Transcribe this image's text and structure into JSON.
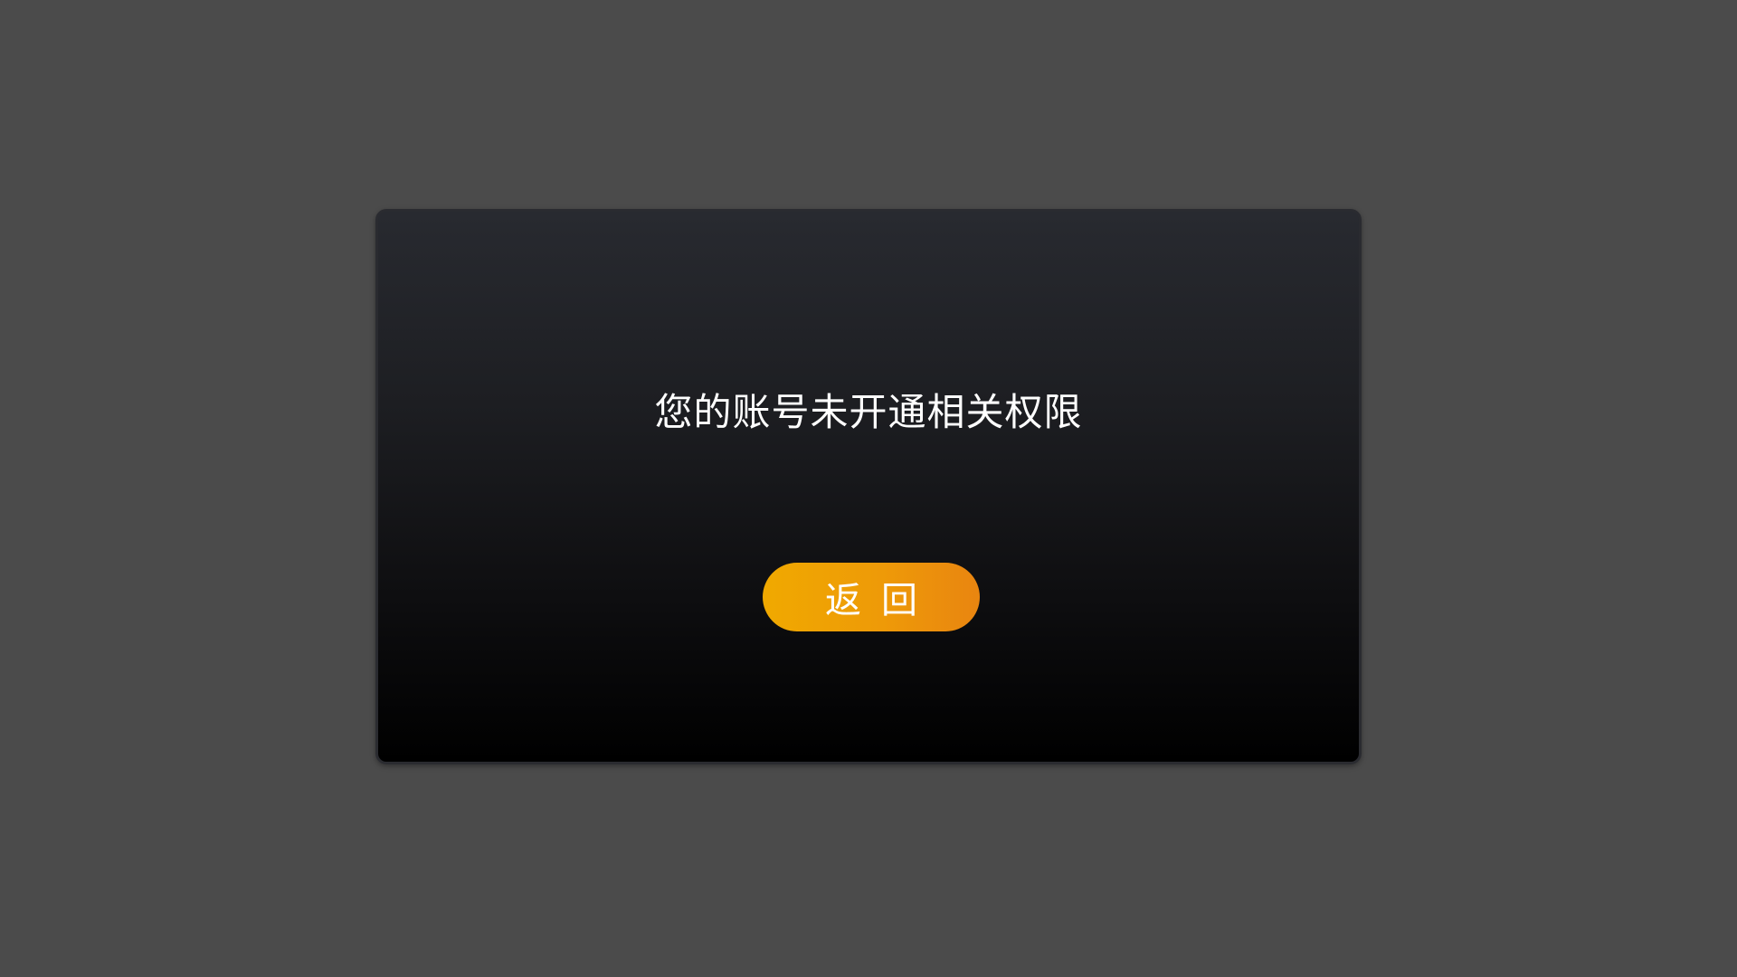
{
  "dialog": {
    "message": "您的账号未开通相关权限",
    "back_label": "返回"
  },
  "colors": {
    "backdrop": "#4b4b4b",
    "dialog_top": "#282a30",
    "dialog_bottom": "#000000",
    "button_start": "#f0a900",
    "button_end": "#e98510",
    "text": "#ffffff"
  }
}
